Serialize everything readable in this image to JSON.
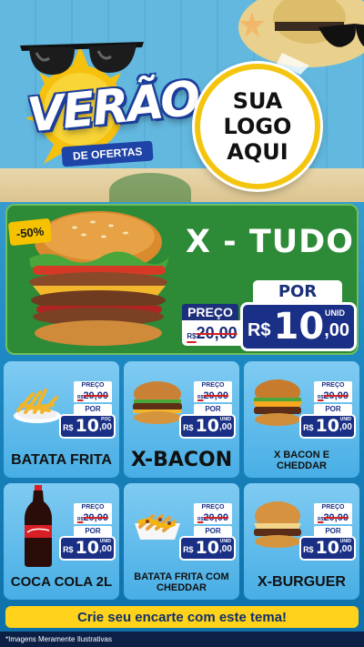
{
  "header": {
    "title": "VERÃO",
    "subtitle": "DE OFERTAS",
    "logo_lines": [
      "SUA",
      "LOGO",
      "AQUI"
    ]
  },
  "featured": {
    "discount": "-50%",
    "name": "X - TUDO",
    "preco_label": "PREÇO",
    "old_currency": "R$",
    "old_price": "20,00",
    "por_label": "POR",
    "unid_label": "UNID",
    "currency": "R$",
    "price_int": "10",
    "price_dec": ",00"
  },
  "products": [
    {
      "name": "BATATA FRITA",
      "preco_label": "PREÇO",
      "old_currency": "R$",
      "old_price": "20,00",
      "por_label": "POR",
      "unid_label": "POÇ",
      "currency": "R$",
      "price_int": "10",
      "price_dec": ",00",
      "image": "fries-icon"
    },
    {
      "name": "X-BACON",
      "preco_label": "PREÇO",
      "old_currency": "R$",
      "old_price": "20,00",
      "por_label": "POR",
      "unid_label": "UNID",
      "currency": "R$",
      "price_int": "10",
      "price_dec": ",00",
      "image": "burger-icon"
    },
    {
      "name": "X BACON E CHEDDAR",
      "preco_label": "PREÇO",
      "old_currency": "R$",
      "old_price": "20,00",
      "por_label": "POR",
      "unid_label": "UNID",
      "currency": "R$",
      "price_int": "10",
      "price_dec": ",00",
      "image": "cheddar-burger-icon"
    },
    {
      "name": "COCA COLA 2L",
      "preco_label": "PREÇO",
      "old_currency": "R$",
      "old_price": "20,00",
      "por_label": "POR",
      "unid_label": "UNID",
      "currency": "R$",
      "price_int": "10",
      "price_dec": ",00",
      "image": "soda-bottle-icon"
    },
    {
      "name": "BATATA FRITA COM CHEDDAR",
      "preco_label": "PREÇO",
      "old_currency": "R$",
      "old_price": "20,00",
      "por_label": "POR",
      "unid_label": "UNID",
      "currency": "R$",
      "price_int": "10",
      "price_dec": ",00",
      "image": "cheddar-fries-icon"
    },
    {
      "name": "X-BURGUER",
      "preco_label": "PREÇO",
      "old_currency": "R$",
      "old_price": "20,00",
      "por_label": "POR",
      "unid_label": "UNID",
      "currency": "R$",
      "price_int": "10",
      "price_dec": ",00",
      "image": "burger-icon"
    }
  ],
  "cta": "Crie seu encarte com este tema!",
  "footnote": "*Imagens Meramente Ilustrativas",
  "colors": {
    "price_blue": "#1a2f86",
    "featured_green": "#2d8a36",
    "cta_yellow": "#ffd31c",
    "sun_yellow": "#f4c50f"
  }
}
